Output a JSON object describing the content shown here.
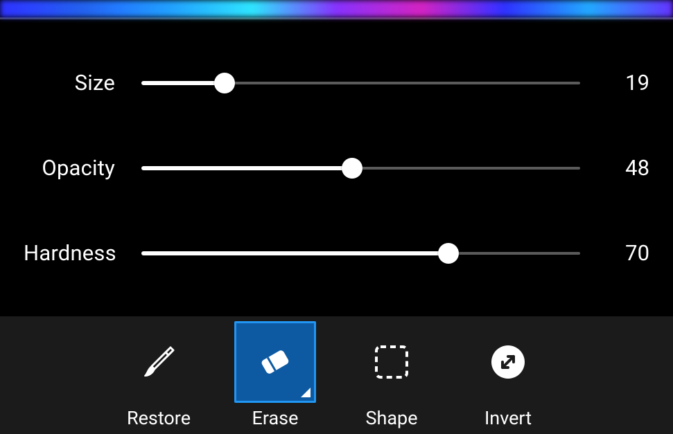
{
  "sliders": {
    "size": {
      "label": "Size",
      "value": 19,
      "min": 0,
      "max": 100
    },
    "opacity": {
      "label": "Opacity",
      "value": 48,
      "min": 0,
      "max": 100
    },
    "hardness": {
      "label": "Hardness",
      "value": 70,
      "min": 0,
      "max": 100
    }
  },
  "toolbar": {
    "selected": "erase",
    "restore": {
      "label": "Restore",
      "icon": "brush-icon"
    },
    "erase": {
      "label": "Erase",
      "icon": "eraser-icon"
    },
    "shape": {
      "label": "Shape",
      "icon": "dashed-rect-icon"
    },
    "invert": {
      "label": "Invert",
      "icon": "invert-icon"
    }
  }
}
